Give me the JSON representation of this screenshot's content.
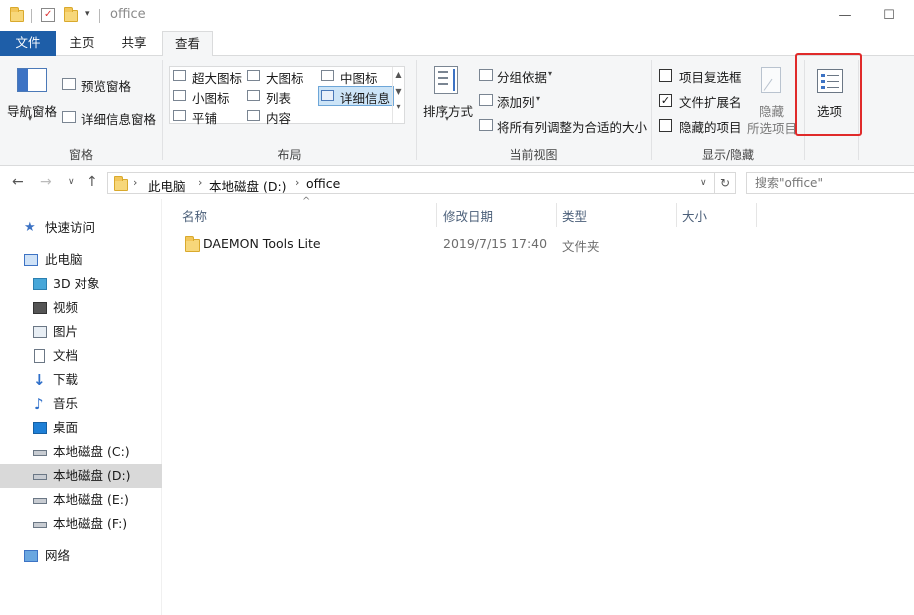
{
  "window": {
    "title": "office",
    "minimize": "—",
    "maximize": "☐"
  },
  "tabs": [
    {
      "label": "文件"
    },
    {
      "label": "主页"
    },
    {
      "label": "共享"
    },
    {
      "label": "查看"
    }
  ],
  "ribbon": {
    "panes": {
      "nav_pane": "导航窗格",
      "preview_pane": "预览窗格",
      "details_pane": "详细信息窗格",
      "group": "窗格"
    },
    "layout": {
      "items": [
        "超大图标",
        "大图标",
        "中图标",
        "小图标",
        "列表",
        "详细信息",
        "平铺",
        "内容"
      ],
      "group": "布局"
    },
    "current_view": {
      "sort": "排序方式",
      "group_by": "分组依据",
      "add_column": "添加列",
      "fit_columns": "将所有列调整为合适的大小",
      "group": "当前视图"
    },
    "show_hide": {
      "item_checkbox": "项目复选框",
      "extensions": "文件扩展名",
      "hidden_items": "隐藏的项目",
      "hide_selected": "隐藏",
      "hide_selected_2": "所选项目",
      "group": "显示/隐藏",
      "checked": {
        "item_checkbox": false,
        "extensions": true,
        "hidden_items": false
      }
    },
    "options": "选项"
  },
  "address": {
    "crumbs": [
      "此电脑",
      "本地磁盘 (D:)",
      "office"
    ],
    "search_placeholder": "搜索\"office\""
  },
  "sidebar": {
    "items": [
      {
        "label": "快速访问"
      },
      {
        "label": "此电脑"
      },
      {
        "label": "3D 对象"
      },
      {
        "label": "视频"
      },
      {
        "label": "图片"
      },
      {
        "label": "文档"
      },
      {
        "label": "下载"
      },
      {
        "label": "音乐"
      },
      {
        "label": "桌面"
      },
      {
        "label": "本地磁盘 (C:)"
      },
      {
        "label": "本地磁盘 (D:)"
      },
      {
        "label": "本地磁盘 (E:)"
      },
      {
        "label": "本地磁盘 (F:)"
      },
      {
        "label": "网络"
      }
    ]
  },
  "filelist": {
    "columns": [
      "名称",
      "修改日期",
      "类型",
      "大小"
    ],
    "rows": [
      {
        "name": "DAEMON Tools Lite",
        "date": "2019/7/15 17:40",
        "type": "文件夹",
        "size": ""
      }
    ]
  },
  "colors": {
    "file_tab": "#1e5ea8",
    "highlight_box": "#e02a2a",
    "selection": "#cce4f7"
  }
}
